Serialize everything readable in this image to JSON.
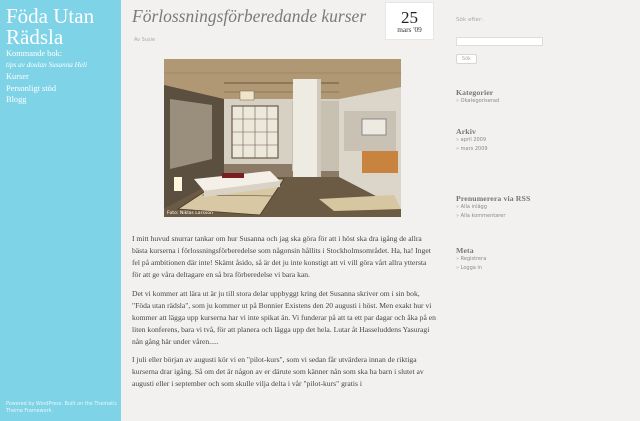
{
  "site": {
    "title": "Föda Utan Rädsla",
    "footer": "Powered by WordPress. Built on the Thematic Theme Framework."
  },
  "nav": {
    "items": [
      {
        "label": "Kommande bok:"
      },
      {
        "label": "tips av doulan Susanna Heli"
      },
      {
        "label": "Kurser"
      },
      {
        "label": "Personligt stöd"
      },
      {
        "label": "Blogg"
      }
    ]
  },
  "post": {
    "title": "Förlossningsförberedande kurser",
    "date_day": "25",
    "date_month": "mars '09",
    "byline": "Av Susie",
    "photo_credit": "Foto: Niklas Larsson",
    "paragraphs": [
      "I mitt huvud snurrar tankar om hur Susanna och jag ska göra för att i höst ska dra igång de allra bästa kurserna i förlossningsförberedelse som någonsin hållits i Stockholmsområdet. Ha, ha! Inget fel på ambitionen där inte! Skämt åsido, så är det ju inte konstigt att vi vill göra vårt allra yttersta för att ge våra deltagare en så bra förberedelse vi bara kan.",
      "Det vi kommer att lära ut är ju till stora delar uppbyggt kring det Susanna skriver om i sin bok, \"Föda utan rädsla\", som ju kommer ut på Bonnier Existens den 20 augusti i höst. Men exakt hur vi kommer att lägga upp kurserna har vi inte spikat än. Vi funderar på att ta ett par dagar och åka på en liten konferens, bara vi två, för att planera och lägga upp det hela. Lutar åt Hasseluddens Yasuragi nån gång här under våren.....",
      "I juli eller början av augusti kör vi en \"pilot-kurs\", som vi sedan får utvärdera innan de riktiga kurserna drar igång. Så om det är någon av er därute som känner nån som ska ha barn i slutet av augusti eller i september och som skulle vilja delta i vår \"pilot-kurs\" gratis i"
    ]
  },
  "sidebar": {
    "search_label": "Sök efter:",
    "search_value": "",
    "search_button": "Sök",
    "widgets": [
      {
        "title": "Kategorier",
        "links": [
          "Okategoriserad"
        ]
      },
      {
        "title": "Arkiv",
        "links": [
          "april 2009",
          "mars 2009"
        ]
      },
      {
        "title": "Prenumerera via RSS",
        "links": [
          "Alla inlägg",
          "Alla kommentarer"
        ]
      },
      {
        "title": "Meta",
        "links": [
          "Registrera",
          "Logga in"
        ]
      }
    ],
    "link_marker": "»"
  },
  "colors": {
    "sidebar_accent": "#7ed3e6",
    "page_background": "#f2f1ef"
  }
}
